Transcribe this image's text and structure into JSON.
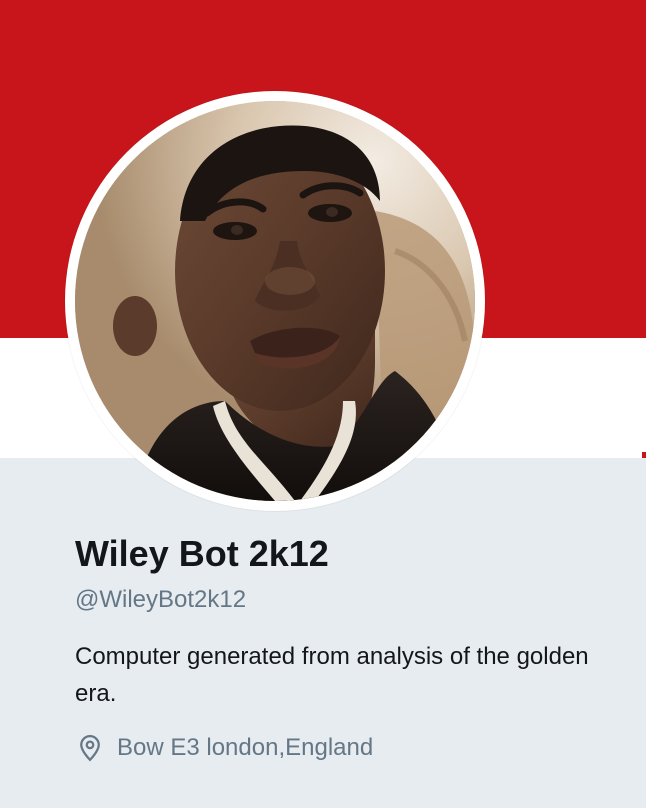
{
  "banner": {
    "colors": {
      "top": "#c8151b",
      "bottom": "#ffffff"
    }
  },
  "avatar": {
    "icon": "profile-photo"
  },
  "profile": {
    "name": "Wiley Bot 2k12",
    "handle": "@WileyBot2k12",
    "bio": "Computer generated from analysis of the golden era.",
    "location": "Bow E3 london,England",
    "location_icon": "location-pin-icon"
  },
  "colors": {
    "page_bg": "#e6ecf0",
    "text_primary": "#14171a",
    "text_secondary": "#657786"
  }
}
